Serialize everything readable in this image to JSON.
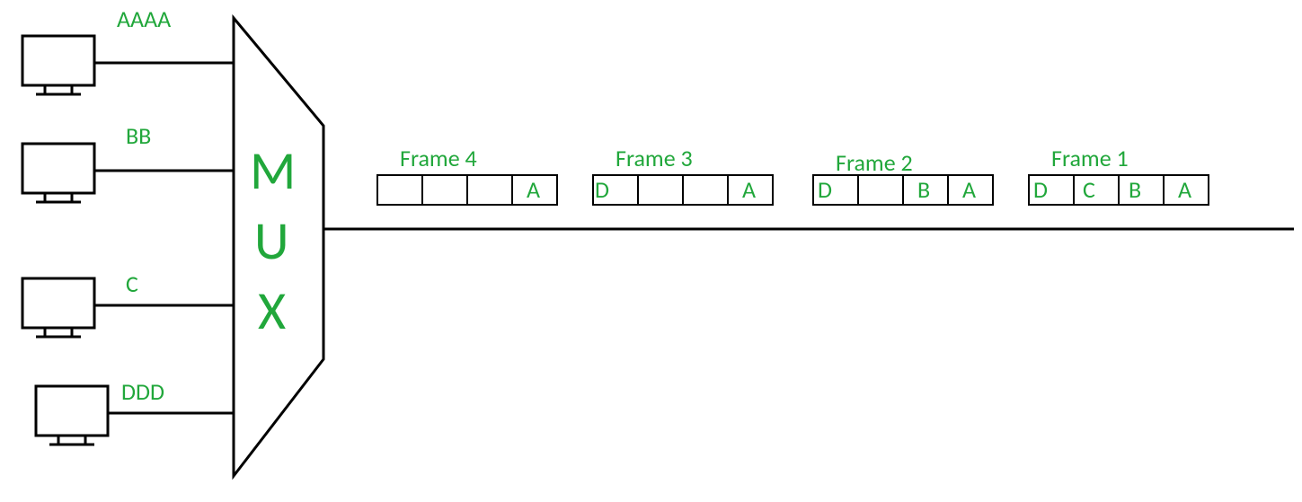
{
  "diagram": {
    "type": "TDM Multiplexing (Synchronous Time-Division Multiplexing)",
    "description": "Four input sources feed a MUX block. Output link carries fixed-slot frames; empty slots are wasted when a source has no data.",
    "mux_label": "MUX",
    "inputs": [
      {
        "id": "A",
        "data_label": "AAAA"
      },
      {
        "id": "B",
        "data_label": "BB"
      },
      {
        "id": "C",
        "data_label": "C"
      },
      {
        "id": "D",
        "data_label": "DDD"
      }
    ],
    "frames": [
      {
        "label": "Frame 4",
        "slots": [
          "",
          "",
          "",
          "A"
        ]
      },
      {
        "label": "Frame 3",
        "slots": [
          "D",
          "",
          "",
          "A"
        ]
      },
      {
        "label": "Frame 2",
        "slots": [
          "D",
          "",
          "B",
          "A"
        ]
      },
      {
        "label": "Frame 1",
        "slots": [
          "D",
          "C",
          "B",
          "A"
        ]
      }
    ],
    "colors": {
      "accent": "#21a73b",
      "line": "#000000"
    }
  }
}
